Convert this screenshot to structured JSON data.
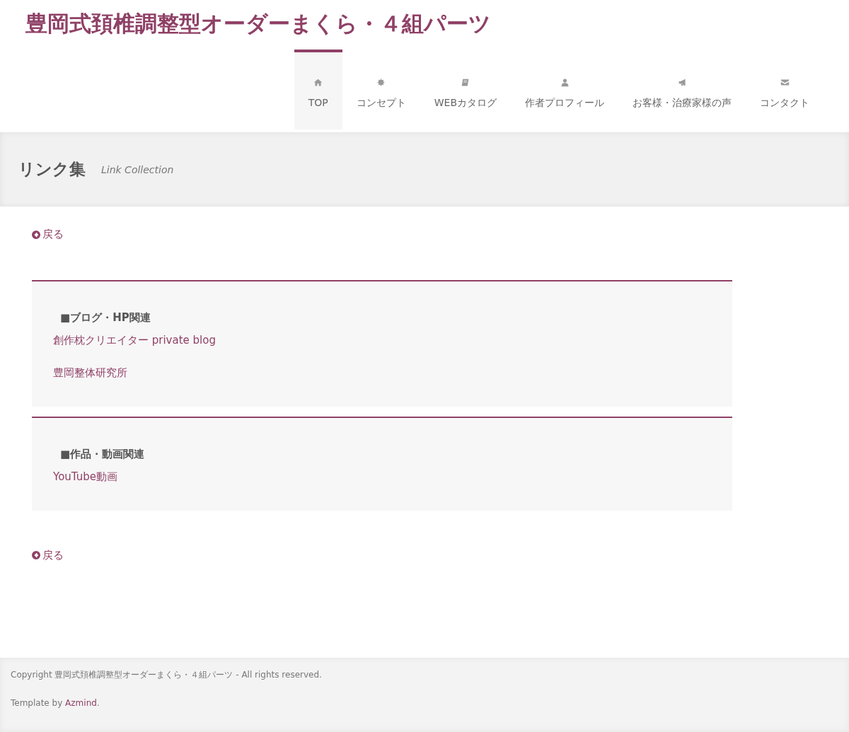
{
  "site_title": "豊岡式頚椎調整型オーダーまくら・４組パーツ",
  "nav": [
    {
      "label": "TOP",
      "kind": "home",
      "selected": true
    },
    {
      "label": "コンセプト",
      "kind": "gear",
      "selected": false
    },
    {
      "label": "WEBカタログ",
      "kind": "book",
      "selected": false
    },
    {
      "label": "作者プロフィール",
      "kind": "user",
      "selected": false
    },
    {
      "label": "お客様・治療家様の声",
      "kind": "bullhorn",
      "selected": false
    },
    {
      "label": "コンタクト",
      "kind": "envelope",
      "selected": false
    }
  ],
  "page_header": {
    "title": "リンク集",
    "subtitle": "Link Collection"
  },
  "back_top": "戻る",
  "sections": [
    {
      "heading": "■ブログ・HP関連",
      "links": [
        "創作枕クリエイター private blog",
        "豊岡整体研究所"
      ]
    },
    {
      "heading": "■作品・動画関連",
      "links": [
        "YouTube動画"
      ]
    }
  ],
  "back_bottom": "戻る",
  "footer": {
    "copyright": "Copyright 豊岡式頚椎調整型オーダーまくら・４組パーツ - All rights reserved.",
    "template_prefix": "Template by ",
    "template_link": "Azmind",
    "template_suffix": "."
  }
}
